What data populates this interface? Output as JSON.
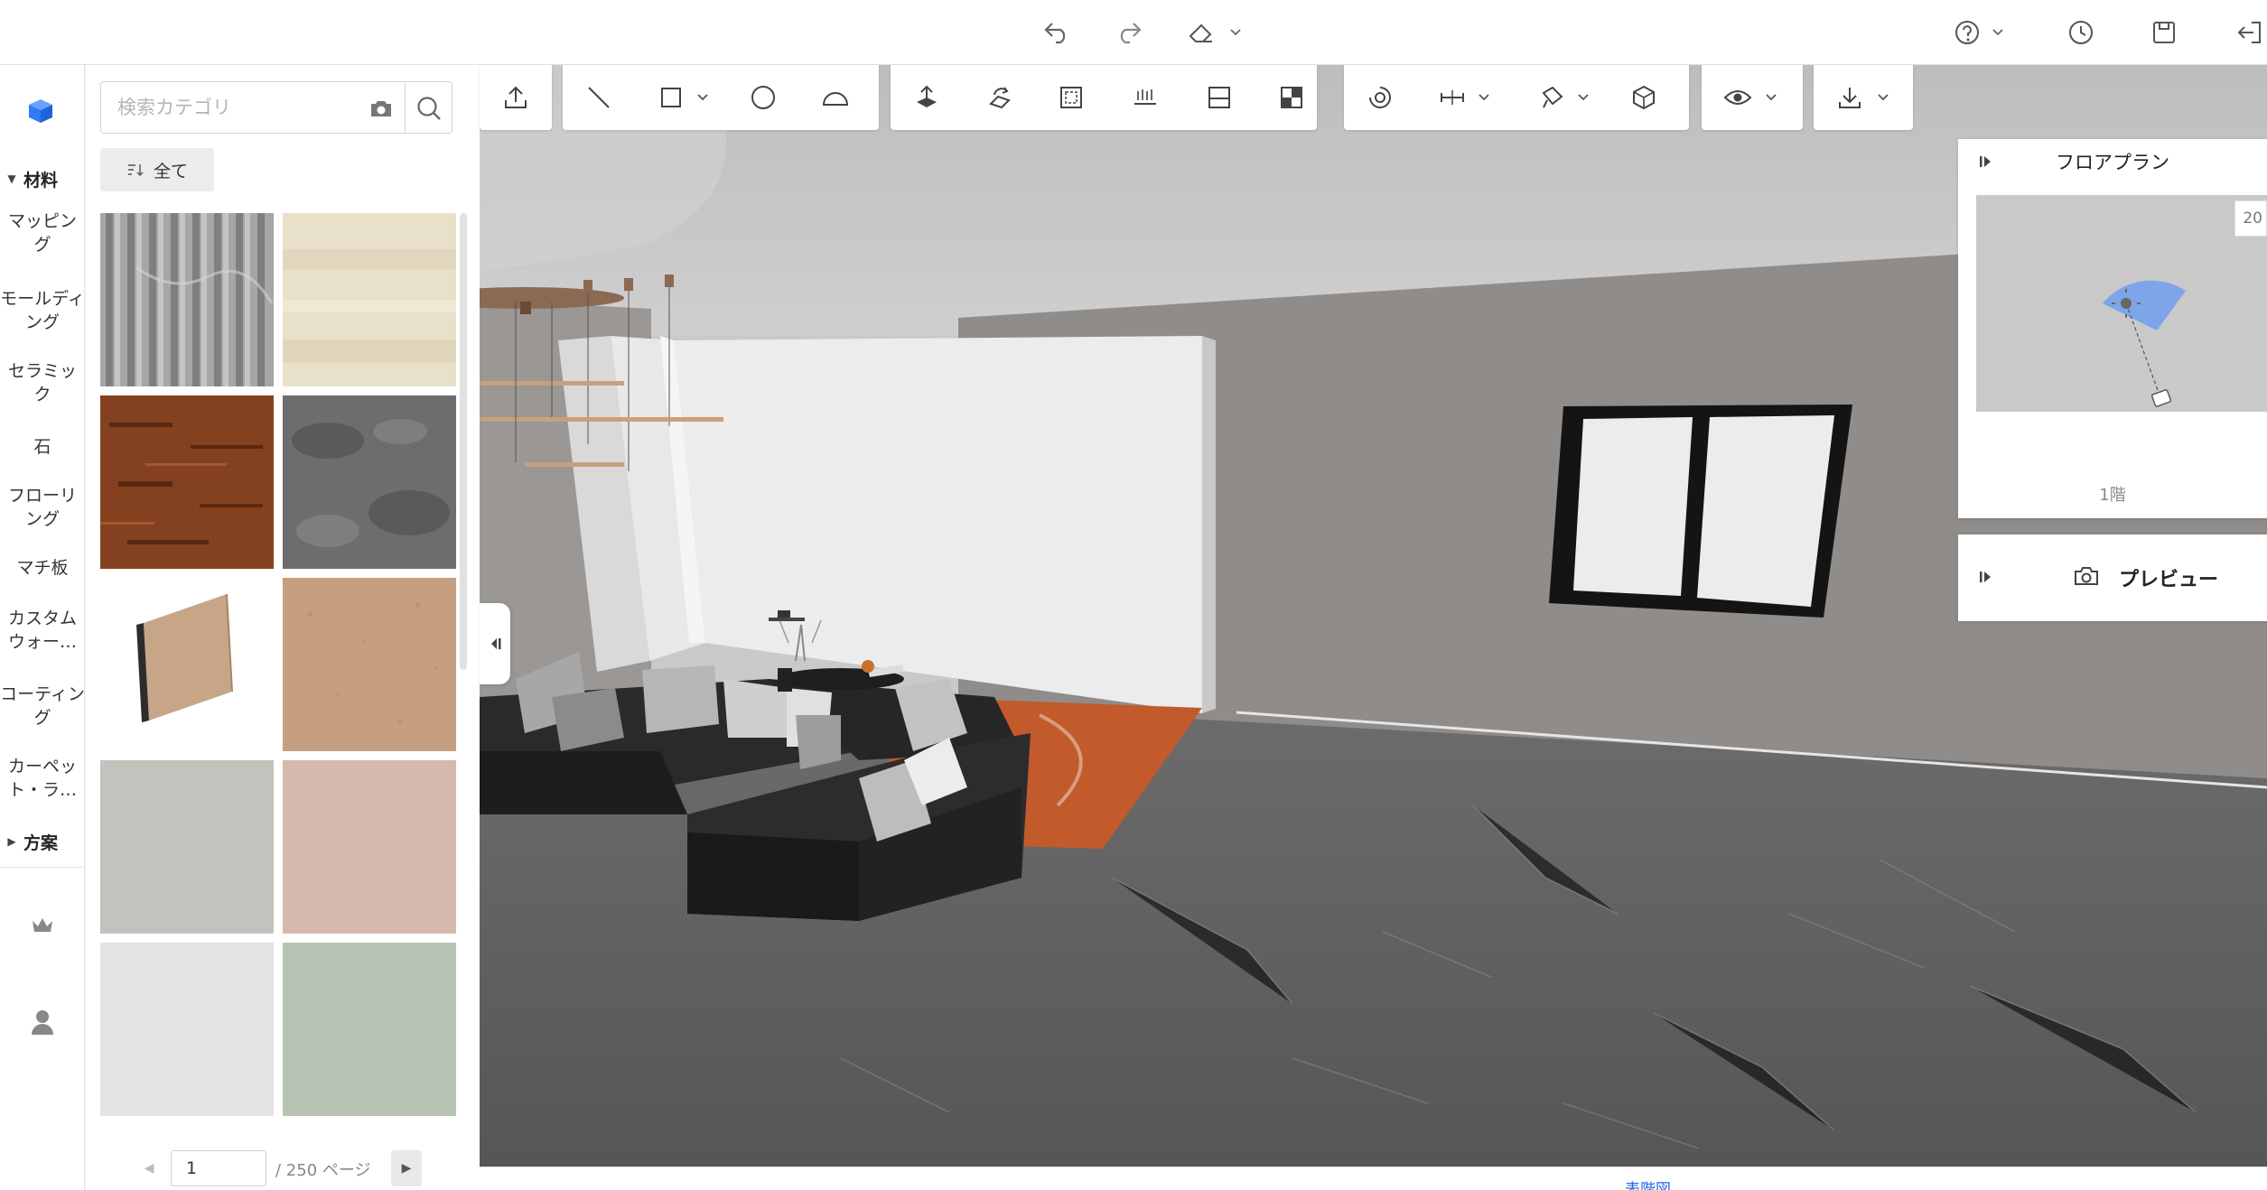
{
  "topbar": {
    "icons": [
      "undo-icon",
      "redo-icon",
      "eraser-icon",
      "help-icon",
      "history-icon",
      "save-icon",
      "exit-icon"
    ]
  },
  "rail": {
    "sections": [
      {
        "label": "材料",
        "expanded": true
      },
      {
        "label": "方案",
        "expanded": false
      }
    ],
    "items": [
      "マッピング",
      "モールディング",
      "セラミック",
      "石",
      "フローリング",
      "マチ板",
      "カスタムウォー…",
      "コーティング",
      "カーペット・ラ…"
    ]
  },
  "catalog": {
    "search_placeholder": "検索カテゴリ",
    "filter_label": "全て",
    "tiles": [
      {
        "name": "grey-fluted-panel",
        "color": "#9a9a9a"
      },
      {
        "name": "cream-stone",
        "color": "#e7dfc6"
      },
      {
        "name": "dark-walnut",
        "color": "#7a3b1e"
      },
      {
        "name": "slate-grey",
        "color": "#6a6a6a"
      },
      {
        "name": "cork-board-panel",
        "color": "#c7a688"
      },
      {
        "name": "terracotta-sand",
        "color": "#c49f80"
      },
      {
        "name": "light-grey-plaster",
        "color": "#c4c2bd"
      },
      {
        "name": "blush-plaster",
        "color": "#d5b7ab"
      },
      {
        "name": "off-white",
        "color": "#e3e3e3"
      },
      {
        "name": "sage-green",
        "color": "#b8c4b3"
      }
    ],
    "pager": {
      "current": "1",
      "total": "/ 250 ページ"
    }
  },
  "floorplan": {
    "title": "フロアプラン",
    "badge": "20",
    "floor_label": "1階"
  },
  "preview": {
    "label": "プレビュー"
  },
  "bottom": {
    "tab_label": "表階図"
  },
  "colors": {
    "accent": "#1d63e6",
    "rail_logo": "#2f7bf5",
    "camera_cone": "#7ea4ea",
    "floor": "#5c5c5c",
    "wall": "#8e8b88",
    "window_frame": "#141414",
    "sofa": "#232323",
    "rug": "#c0562a"
  }
}
